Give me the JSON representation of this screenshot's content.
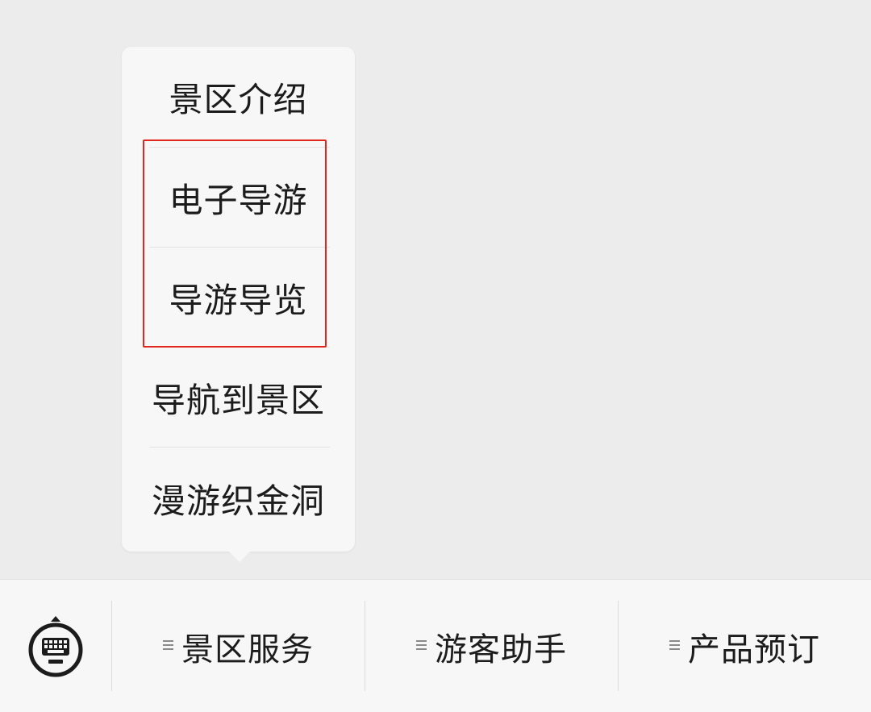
{
  "popup_menu": {
    "items": [
      {
        "label": "景区介绍"
      },
      {
        "label": "电子导游"
      },
      {
        "label": "导游导览"
      },
      {
        "label": "导航到景区"
      },
      {
        "label": "漫游织金洞"
      }
    ]
  },
  "bottom_bar": {
    "keyboard_icon": "keyboard-icon",
    "tabs": [
      {
        "label": "景区服务",
        "icon": "menu-lines-icon"
      },
      {
        "label": "游客助手",
        "icon": "menu-lines-icon"
      },
      {
        "label": "产品预订",
        "icon": "menu-lines-icon"
      }
    ]
  },
  "colors": {
    "background": "#ececec",
    "panel": "#f7f7f7",
    "text": "#1c1c1c",
    "highlight_border": "#e3261b"
  }
}
